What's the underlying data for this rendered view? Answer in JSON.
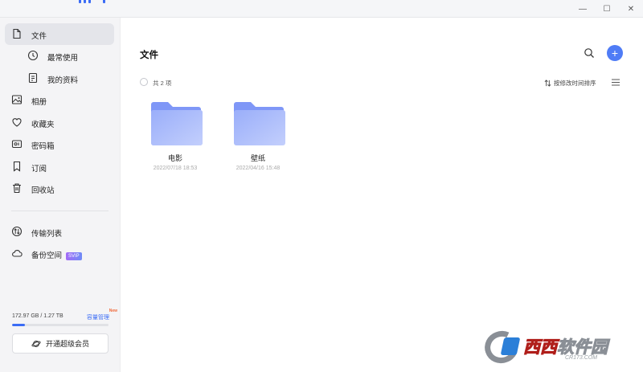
{
  "window": {
    "controls": {
      "minimize": "—",
      "maximize": "☐",
      "close": "✕"
    }
  },
  "sidebar": {
    "items": [
      {
        "label": "文件",
        "icon": "file-icon"
      },
      {
        "label": "最常使用",
        "icon": "clock-icon"
      },
      {
        "label": "我的资料",
        "icon": "document-icon"
      },
      {
        "label": "相册",
        "icon": "image-icon"
      },
      {
        "label": "收藏夹",
        "icon": "heart-icon"
      },
      {
        "label": "密码箱",
        "icon": "safe-icon"
      },
      {
        "label": "订阅",
        "icon": "bookmark-icon"
      },
      {
        "label": "回收站",
        "icon": "trash-icon"
      },
      {
        "label": "传输列表",
        "icon": "transfer-icon"
      },
      {
        "label": "备份空间",
        "icon": "cloud-icon",
        "badge": "SVIP"
      }
    ],
    "storage": {
      "used_text": "172.97 GB / 1.27 TB",
      "manage_label": "容量管理",
      "new_badge": "New",
      "used_fraction": 0.133
    },
    "vip_button": "开通超级会员"
  },
  "main": {
    "title": "文件",
    "count_text": "共 2 项",
    "sort_label": "按修改时间排序",
    "files": [
      {
        "name": "电影",
        "date": "2022/07/18 18:53"
      },
      {
        "name": "壁纸",
        "date": "2022/04/16 15:48"
      }
    ]
  },
  "watermark": {
    "text_red": "西西",
    "text_rest": "软件园",
    "url": "CR173.COM"
  },
  "colors": {
    "accent": "#4f7cf6",
    "folder_back": "#7f97f7",
    "folder_front": "#a9b9fb",
    "sidebar_bg": "#f4f4f6",
    "active_bg": "#e4e5ea"
  }
}
